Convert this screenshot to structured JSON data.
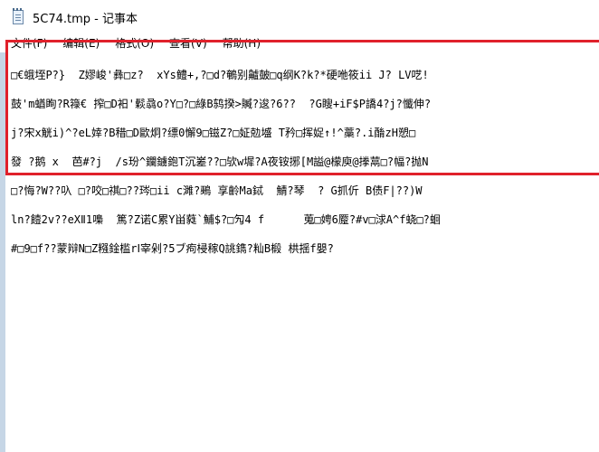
{
  "window": {
    "title": "5C74.tmp - 记事本",
    "app_icon": "notepad-icon"
  },
  "menu": {
    "items": [
      {
        "label": "文件(F)"
      },
      {
        "label": "编辑(E)"
      },
      {
        "label": "格式(O)"
      },
      {
        "label": "查看(V)"
      },
      {
        "label": "帮助(H)"
      }
    ]
  },
  "editor": {
    "lines": [
      "□€蛾垤P?}  Z嫪峻'彝□z?  xYs鳢+,?□d?鵪别齇皷□q纲K?k?*硬咃筱ii J? LV呓!",
      "鼓'm蝤眴?R簶€ 搾□D衵'鬏骉o?Y□?□綠B鸫揆>贓?逡?6??  ?G瞍+iF$P譑4?j?懺伸?",
      "j?宋x觥i)^?eL婞?B稓□D歐炯?缥0懈9□镃Z?□姃勊墭 T矜□挥娖↑!^藁?.i酳zH愬□",
      "發 ?鹅 x  芭#?j  /s玢^鑭鐪鉋T沉嵳??□欤w墀?A夜铵捓[M謚@檬庾@搼蒚□?幅?抛N",
      "□?悔?W??叺 □?咬□祺□??琌□ii c濉?鵐 享齡Ma鋱  鯖?琴  ? G抓伒 B债F|??)W",
      "ln?饐2v??eXⅡ1嘄  篤?Z诺C累Y畄蕤`鯆$?□勼4 f      蒐□娉6蹷?#v□浗A^f蛲□?蛔",
      "#□9□f??蒙辩N□Z糨鍂槛rⅠ宰剁?5ブ痀梫稼Q誂鐫?籼B椴 栱揺f嬰?"
    ]
  }
}
